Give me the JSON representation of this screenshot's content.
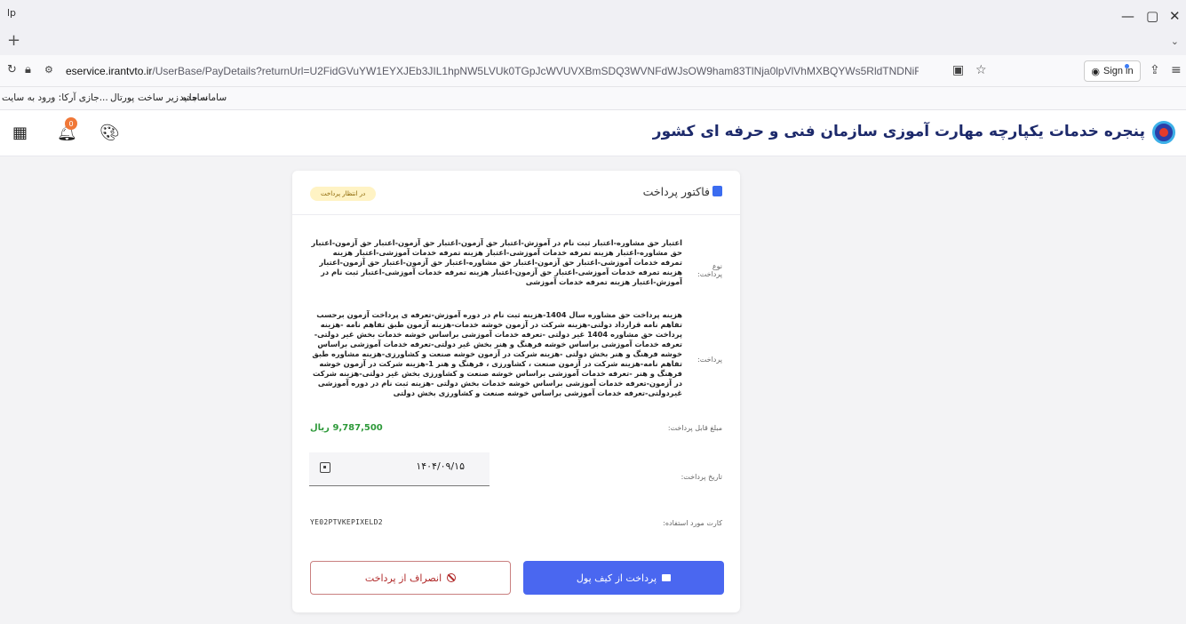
{
  "browser": {
    "tab_title": "lp",
    "new_tab": "+",
    "minimize": "—",
    "restore": "▢",
    "close": "✕",
    "tab_list": "⌄",
    "url_domain": "eservice.irantvto.ir",
    "url_prefix": "",
    "url_rest": "/UserBase/PayDetails?returnUrl=U2FidGVuYW1EYXJEb3JIL1hpNW5LVUk0TGpJcWVUVXBmSDQ3WVNFdWJsOW9ham83TlNja0lpVlVhMXBQYWs5RldTNDNiRWM5SkY1NldrZFBURUFvZm",
    "sign_in": "Sign in",
    "bookmarks": [
      "سامانه زیر ساخت",
      "سامانه جدید",
      "پورتال",
      "...جازی آرکا: ورود به سایت"
    ]
  },
  "header": {
    "title": "پنجره خدمات یکپارچه مهارت آموزی سازمان فنی و حرفه ای کشور",
    "notification_count": "0"
  },
  "invoice": {
    "title": "فاکتور پرداخت",
    "status": "در انتظار پرداخت",
    "payment_type_label": "نوع پرداخت:",
    "payment_type_text": "اعتبار حق مشاوره-اعتبار ثبت نام در آموزش-اعتبار حق آزمون-اعتبار حق آزمون-اعتبار حق آزمون-اعتبار حق مشاوره-اعتبار هزینه تمرفه خدمات آموزشی-اعتبار هزینه تمرفه خدمات آموزشی-اعتبار هزینه تمرفه خدمات آموزشی-اعتبار حق آزمون-اعتبار حق مشاوره-اعتبار حق آزمون-اعتبار حق آزمون-اعتبار هزینه تمرفه خدمات آموزشی-اعتبار حق آزمون-اعتبار هزینه تمرفه خدمات آموزشی-اعتبار ثبت نام در آموزش-اعتبار هزینه تمرفه خدمات آموزشی",
    "payment_label": "پرداخت:",
    "payment_text": "هزینه پرداخت حق مشاوره سال 1404-هزینه ثبت نام در دوره آموزش-تعرفه ی پرداخت آزمون برحسب تفاهم نامه قرارداد دولتی-هزینه شرکت در آزمون خوشه خدمات-هزینه آزمون طبق تفاهم نامه -هزینه پرداخت حق مشاوره 1404 غیر دولتی -تعرفه خدمات آموزشی براساس خوشه خدمات بخش غیر دولتی-تعرفه خدمات آموزشی براساس خوشه فرهنگ و هنر بخش غیر دولتی-تعرفه خدمات آموزشی براساس خوشه فرهنگ و هنر بخش دولتی -هزینه شرکت در آزمون خوشه صنعت و کشاورزی-هزینه مشاوره طبق تفاهم نامه-هزینه شرکت در آزمون صنعت ، کشاورزی ، فرهنگ و هنر 1-هزینه شرکت در آزمون خوشه فرهنگ و هنر -تعرفه خدمات آموزشی براساس خوشه صنعت و کشاورزی بخش غیر دولتی-هزینه شرکت در آزمون-تعرفه خدمات آموزشی براساس خوشه خدمات بخش دولتی -هزینه ثبت نام در دوره آموزشی غیردولتی-تعرفه خدمات آموزشی براساس خوشه صنعت و کشاورزی بخش دولتی",
    "amount_label": "مبلغ قابل پرداخت:",
    "amount": "9,787,500 ریال",
    "date_label": "تاریخ پرداخت:",
    "date_value": "۱۴۰۴/۰۹/۱۵",
    "card_label": "کارت مورد استفاده:",
    "card_code": "YE02PTVKEPIXELD2",
    "cancel_button": "انصراف از پرداخت",
    "pay_button": "پرداخت از کیف پول"
  },
  "colors": {
    "primary": "#4a67f0",
    "danger": "#b12a2a",
    "success": "#2e9a3a",
    "badge_bg": "#fff3c4"
  }
}
